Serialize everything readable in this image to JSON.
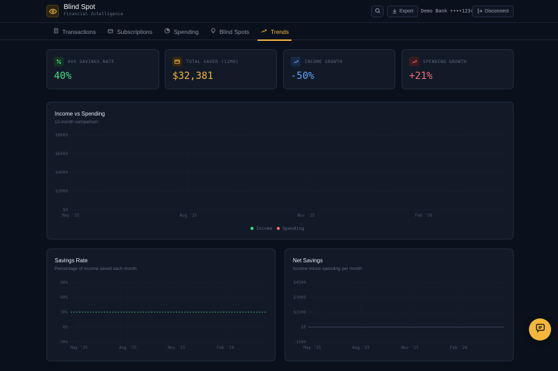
{
  "app": {
    "title": "Blind Spot",
    "subtitle": "Financial Intelligence"
  },
  "header": {
    "export_label": "Export",
    "bank_label": "Demo Bank ••••1234",
    "disconnect_label": "Disconnect"
  },
  "nav": {
    "tabs": [
      {
        "label": "Transactions",
        "icon": "receipt-icon"
      },
      {
        "label": "Subscriptions",
        "icon": "card-icon"
      },
      {
        "label": "Spending",
        "icon": "pie-icon"
      },
      {
        "label": "Blind Spots",
        "icon": "lightbulb-icon"
      },
      {
        "label": "Trends",
        "icon": "trending-up-icon",
        "active": true
      }
    ]
  },
  "stats": [
    {
      "label": "AVG SAVINGS RATE",
      "value": "40%",
      "color": "#4ade80",
      "icon": "percent-icon",
      "icon_bg": "#123322"
    },
    {
      "label": "TOTAL SAVED (12MO)",
      "value": "$32,381",
      "color": "#f5b73b",
      "icon": "wallet-icon",
      "icon_bg": "#332810"
    },
    {
      "label": "INCOME GROWTH",
      "value": "-50%",
      "color": "#60a5fa",
      "icon": "trending-up-icon",
      "icon_bg": "#172a45"
    },
    {
      "label": "SPENDING GROWTH",
      "value": "+21%",
      "color": "#f87171",
      "icon": "trending-up-icon",
      "icon_bg": "#3a1a20"
    }
  ],
  "income_vs_spending": {
    "title": "Income vs Spending",
    "subtitle": "12-month comparison",
    "legend": [
      "Income",
      "Spending"
    ]
  },
  "savings_rate": {
    "title": "Savings Rate",
    "subtitle": "Percentage of income saved each month"
  },
  "net_savings": {
    "title": "Net Savings",
    "subtitle": "Income minus spending per month"
  },
  "colors": {
    "accent": "#f5b73b",
    "income": "#4ade80",
    "spending": "#f87171"
  },
  "chart_data": [
    {
      "type": "line",
      "title": "Income vs Spending",
      "yticks": [
        "$8000",
        "$6000",
        "$4000",
        "$2000",
        "$0"
      ],
      "xticks": [
        "May '25",
        "Aug '25",
        "Nov '25",
        "Feb '26"
      ],
      "ylim": [
        0,
        8000
      ],
      "legend_position": "bottom",
      "series": [
        {
          "name": "Income",
          "values": []
        },
        {
          "name": "Spending",
          "values": []
        }
      ]
    },
    {
      "type": "line",
      "title": "Savings Rate",
      "yticks": [
        "90%",
        "60%",
        "30%",
        "0%",
        "-30%"
      ],
      "xticks": [
        "May '25",
        "Aug '25",
        "Nov '25",
        "Feb '26"
      ],
      "ylim": [
        -30,
        90
      ],
      "reference_line": 30
    },
    {
      "type": "bar",
      "title": "Net Savings",
      "yticks": [
        "$4500",
        "$3000",
        "$1500",
        "$0",
        "-1500"
      ],
      "xticks": [
        "May '25",
        "Aug '25",
        "Nov '25",
        "Feb '26"
      ],
      "ylim": [
        -1500,
        4500
      ]
    }
  ]
}
